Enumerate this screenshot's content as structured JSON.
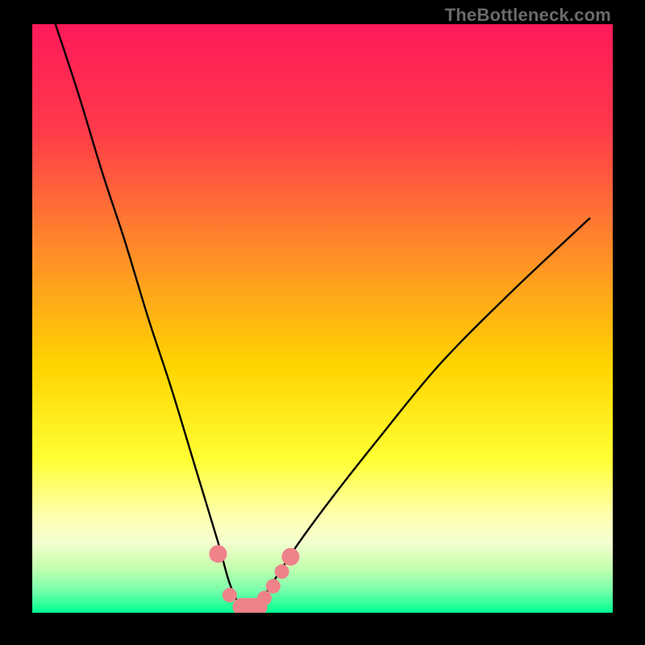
{
  "watermark_text": "TheBottleneck.com",
  "accent_colors": {
    "curve": "#000000",
    "marker_fill": "#f0828a",
    "gradient_top": "#ff1a5a",
    "gradient_mid1": "#ff7a2a",
    "gradient_mid2": "#ffd400",
    "gradient_mid3": "#ffff66",
    "gradient_bottom1": "#9cff66",
    "gradient_bottom2": "#00ff88"
  },
  "chart_data": {
    "type": "line",
    "title": "",
    "xlabel": "",
    "ylabel": "",
    "x_range_pct": [
      0,
      100
    ],
    "y_range_bottleneck_pct": [
      0,
      100
    ],
    "note": "Bottleneck curve on a vertical heat gradient. Lower y = lower bottleneck (green). The curve is a V shape with minimum (optimal balance) at roughly x≈36% and a flat near-zero trough ~34–40%. Right branch rises more slowly than the left.",
    "series": [
      {
        "name": "bottleneck-curve",
        "x_pct": [
          4,
          8,
          12,
          16,
          20,
          24,
          28,
          32,
          34,
          36,
          38,
          40,
          42,
          46,
          52,
          60,
          70,
          82,
          96
        ],
        "y_pct": [
          100,
          88,
          75,
          63,
          50,
          38,
          25,
          12,
          5,
          1,
          1,
          3,
          6,
          12,
          20,
          30,
          42,
          54,
          67
        ]
      }
    ],
    "markers": {
      "name": "highlighted-points",
      "x_pct": [
        32,
        34,
        36,
        38,
        40,
        41.5,
        43,
        44.5
      ],
      "y_pct": [
        10,
        3,
        1,
        1,
        2.5,
        4.5,
        7,
        9.5
      ],
      "radius_hint": "two slightly larger at ends, inner ones smaller; middle two blend into a rounded-rect trough segment"
    }
  }
}
